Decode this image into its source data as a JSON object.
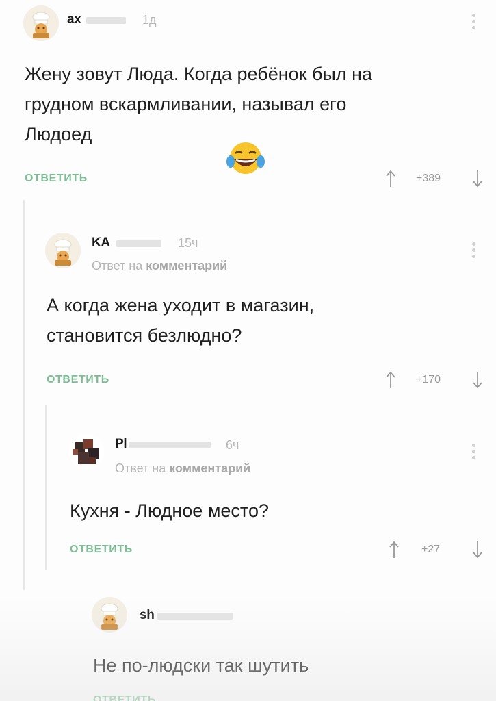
{
  "comments": [
    {
      "username": "ax",
      "time": "1д",
      "text_lines": [
        "Жену зовут Люда. Когда ребёнок был на",
        "грудном вскармливании, называл его",
        "Людоед"
      ],
      "reply_label": "ОТВЕТИТЬ",
      "score": "+389",
      "emoji": "😂"
    },
    {
      "username": "KA",
      "time": "15ч",
      "reply_prefix": "Ответ на",
      "reply_target": "комментарий",
      "text_lines": [
        "А когда жена уходит в магазин,",
        "становится безлюдно?"
      ],
      "reply_label": "ОТВЕТИТЬ",
      "score": "+170"
    },
    {
      "username": "Pl",
      "time": "6ч",
      "reply_prefix": "Ответ на",
      "reply_target": "комментарий",
      "text_lines": [
        "Кухня - Людное место?"
      ],
      "reply_label": "ОТВЕТИТЬ",
      "score": "+27"
    },
    {
      "username": "sh",
      "text_lines": [
        "Не по-людски так шутить"
      ],
      "reply_label": "ОТВЕТИТЬ"
    }
  ],
  "colors": {
    "reply_button": "#7dbf95",
    "thread_line": "#e6e6e6",
    "muted_text": "#b5b5b5"
  },
  "icons": {
    "avatar_default": "chef-avatar-icon",
    "avatar_photo": "user-photo-avatar",
    "upvote": "arrow-up-icon",
    "downvote": "arrow-down-icon",
    "more": "more-vertical-icon"
  }
}
